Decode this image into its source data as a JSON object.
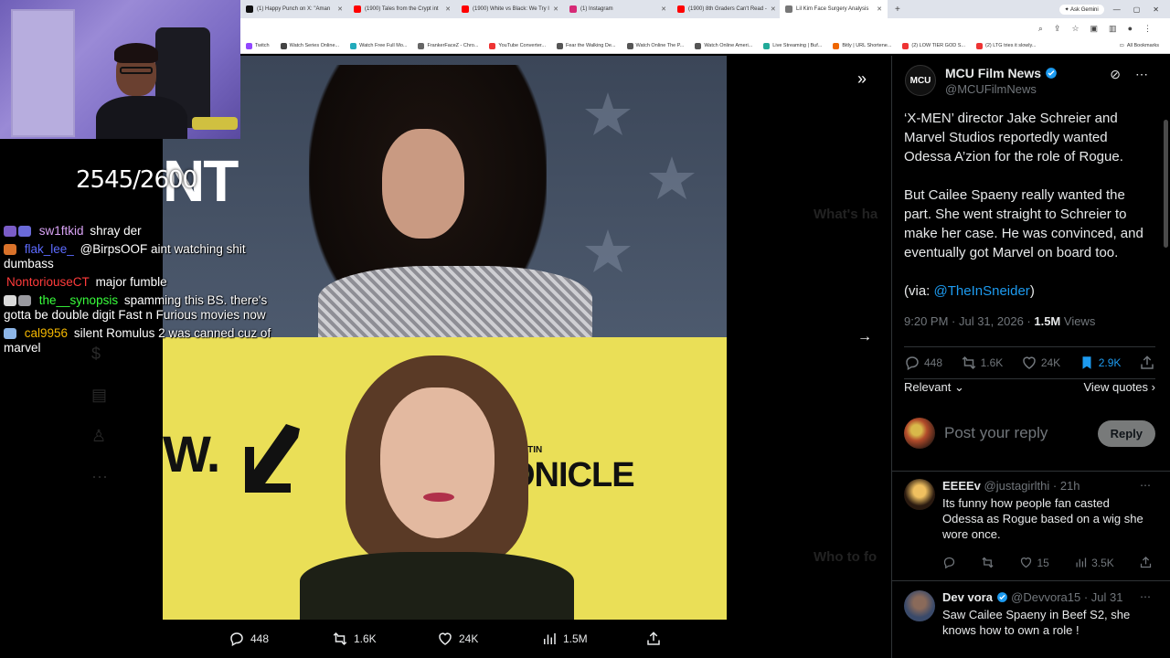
{
  "browser": {
    "tabs": [
      {
        "label": "(1) Happy Punch on X: \"Aman",
        "color": "#111111"
      },
      {
        "label": "(1900) Tales from the Crypt int",
        "color": "#ff0000"
      },
      {
        "label": "(1900) White vs Black: We Try I",
        "color": "#ff0000"
      },
      {
        "label": "(1) Instagram",
        "color": "#d62976"
      },
      {
        "label": "(1900) 8th Graders Can't Read -",
        "color": "#ff0000"
      },
      {
        "label": "Lil Kim Face Surgery Analysis",
        "color": "#777777"
      }
    ],
    "new_tab": "+",
    "ask_gemini": "Ask Gemini",
    "bookmarks": [
      "Twitch",
      "Watch Series Online...",
      "Watch Free Full Mo...",
      "FrankerFaceZ - Chro...",
      "YouTube Converter...",
      "Fear the Walking De...",
      "Watch Online The P...",
      "Watch Online Ameri...",
      "Live Streaming | Buf...",
      "Bitly | URL Shortene...",
      "(2) LOW TIER GOD S...",
      "(2) LTG tries it slowly..."
    ],
    "all_bookmarks": "All Bookmarks"
  },
  "stream": {
    "counter": "2545/2600",
    "chat": [
      {
        "user": "sw1ftkid",
        "user_color": "#d9a3f5",
        "text": "shray der",
        "badges": [
          "#7a5cc7",
          "#6a6ad8"
        ]
      },
      {
        "user": "flak_lee_",
        "user_color": "#5d6bff",
        "text": "@BirpsOOF aint watching shit dumbass",
        "badges": [
          "#d9722a"
        ]
      },
      {
        "user": "NontoriouseCT",
        "user_color": "#ff3b3b",
        "text": "major fumble",
        "badges": []
      },
      {
        "user": "the__synopsis",
        "user_color": "#39ff3c",
        "text": "spamming this BS. there's gotta be double digit Fast n Furious movies now",
        "badges": [
          "#d9d9d9",
          "#9a9aa0"
        ]
      },
      {
        "user": "cal9956",
        "user_color": "#f5b800",
        "text": "silent Romulus 2 was canned cuz of marvel",
        "badges": [
          "#8db6e8"
        ]
      }
    ]
  },
  "media": {
    "top_sign_text": "NT",
    "bottom_sign_text_left": "W.",
    "bottom_sign_small": "AUSTIN",
    "bottom_sign_large": "ONICLE",
    "bar": {
      "replies": "448",
      "reposts": "1.6K",
      "likes": "24K",
      "views": "1.5M"
    }
  },
  "tweet": {
    "author_name": "MCU Film News",
    "author_handle": "@MCUFilmNews",
    "logo_text": "MCU",
    "paragraphs": [
      "‘X-MEN’ director Jake Schreier and Marvel Studios reportedly wanted Odessa A’zion for the role of Rogue.",
      "But Cailee Spaeny really wanted the part. She went straight to Schreier to make her case. He was convinced, and eventually got Marvel on board too."
    ],
    "via_prefix": "(via: ",
    "via_link": "@TheInSneider",
    "via_suffix": ")",
    "timestamp": "9:20 PM · Jul 31, 2026 · ",
    "views_count": "1.5M",
    "views_label": " Views",
    "stats": {
      "replies": "448",
      "reposts": "1.6K",
      "likes": "24K",
      "bookmarks": "2.9K"
    },
    "sort_label": "Relevant",
    "view_quotes": "View quotes",
    "reply_placeholder": "Post your reply",
    "reply_button": "Reply"
  },
  "replies": [
    {
      "name": "EEEEv",
      "handle": "@justagirlthi · 21h",
      "text": "Its funny how people fan casted Odessa as Rogue based on a wig she wore once.",
      "stats": {
        "replies": "",
        "reposts": "",
        "likes": "15",
        "views": "3.5K"
      }
    },
    {
      "name": "Dev vora",
      "handle": "@Devvora15 · Jul 31",
      "text": "Saw Cailee Spaeny in Beef S2, she knows how to own a role !",
      "stats": {
        "replies": "",
        "reposts": "",
        "likes": "",
        "views": ""
      }
    }
  ]
}
